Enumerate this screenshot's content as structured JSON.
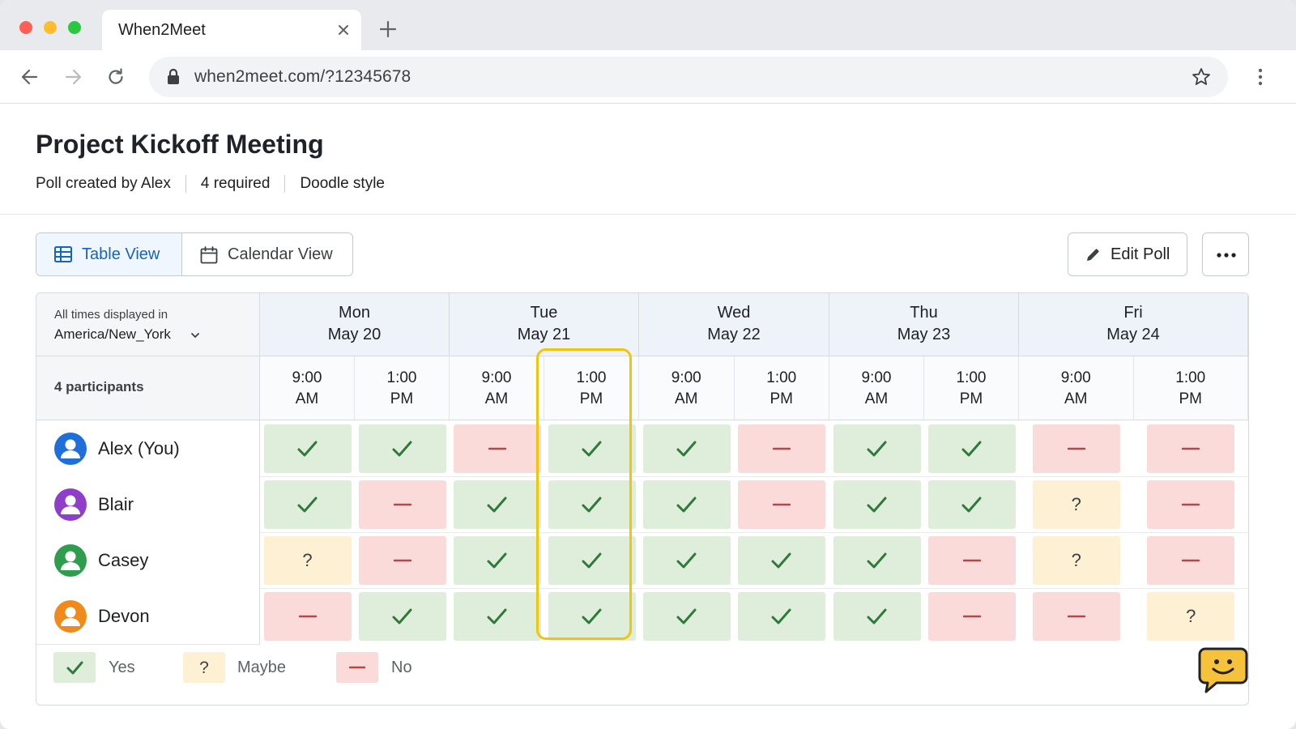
{
  "browser": {
    "tab_title": "When2Meet",
    "url": "when2meet.com/?12345678"
  },
  "poll": {
    "title": "Project Kickoff Meeting",
    "meta": [
      "Poll created by Alex",
      "4 required",
      "Doodle style"
    ]
  },
  "views": {
    "table_label": "Table View",
    "calendar_label": "Calendar View",
    "active": "Table View"
  },
  "actions": {
    "edit_label": "Edit Poll"
  },
  "grid": {
    "timezone_label": "All times displayed in",
    "timezone_value": "America/New_York",
    "participants_label": "4 participants",
    "days": [
      {
        "name": "Mon",
        "date": "May 20"
      },
      {
        "name": "Tue",
        "date": "May 21"
      },
      {
        "name": "Wed",
        "date": "May 22"
      },
      {
        "name": "Thu",
        "date": "May 23"
      },
      {
        "name": "Fri",
        "date": "May 24"
      }
    ],
    "slots": [
      {
        "time": "9:00",
        "ampm": "AM"
      },
      {
        "time": "1:00",
        "ampm": "PM"
      },
      {
        "time": "9:00",
        "ampm": "AM"
      },
      {
        "time": "1:00",
        "ampm": "PM"
      },
      {
        "time": "9:00",
        "ampm": "AM"
      },
      {
        "time": "1:00",
        "ampm": "PM"
      },
      {
        "time": "9:00",
        "ampm": "AM"
      },
      {
        "time": "1:00",
        "ampm": "PM"
      },
      {
        "time": "9:00",
        "ampm": "AM"
      },
      {
        "time": "1:00",
        "ampm": "PM"
      }
    ],
    "highlighted_slot_index": 3,
    "participants": [
      {
        "name": "Alex (You)",
        "avatar_color": "#1e6fd9",
        "responses": [
          "yes",
          "yes",
          "no",
          "yes",
          "yes",
          "no",
          "yes",
          "yes",
          "no",
          "no"
        ]
      },
      {
        "name": "Blair",
        "avatar_color": "#8e3ec8",
        "responses": [
          "yes",
          "no",
          "yes",
          "yes",
          "yes",
          "no",
          "yes",
          "yes",
          "maybe",
          "no"
        ]
      },
      {
        "name": "Casey",
        "avatar_color": "#2e9d4e",
        "responses": [
          "maybe",
          "no",
          "yes",
          "yes",
          "yes",
          "yes",
          "yes",
          "no",
          "maybe",
          "no"
        ]
      },
      {
        "name": "Devon",
        "avatar_color": "#f08a1c",
        "responses": [
          "no",
          "yes",
          "yes",
          "yes",
          "yes",
          "yes",
          "yes",
          "no",
          "no",
          "maybe"
        ]
      }
    ]
  },
  "legend": [
    {
      "type": "yes",
      "label": "Yes"
    },
    {
      "type": "maybe",
      "label": "Maybe",
      "symbol": "?"
    },
    {
      "type": "no",
      "label": "No"
    }
  ],
  "colors": {
    "yes": "#dfeedb",
    "no": "#fbdada",
    "maybe": "#fdf0d3",
    "check": "#2f7a3a",
    "dash": "#b3474a",
    "highlight": "#f1c40f",
    "accent": "#1565c0",
    "chat_fab": "#f7c23b"
  },
  "icons": [
    "back-arrow-icon",
    "forward-arrow-icon",
    "reload-icon",
    "lock-icon",
    "star-icon",
    "kebab-menu-icon",
    "table-icon",
    "calendar-icon",
    "pencil-icon",
    "more-horizontal-icon",
    "chevron-down-icon",
    "person-icon",
    "check-icon",
    "dash-icon",
    "chat-smile-icon"
  ]
}
